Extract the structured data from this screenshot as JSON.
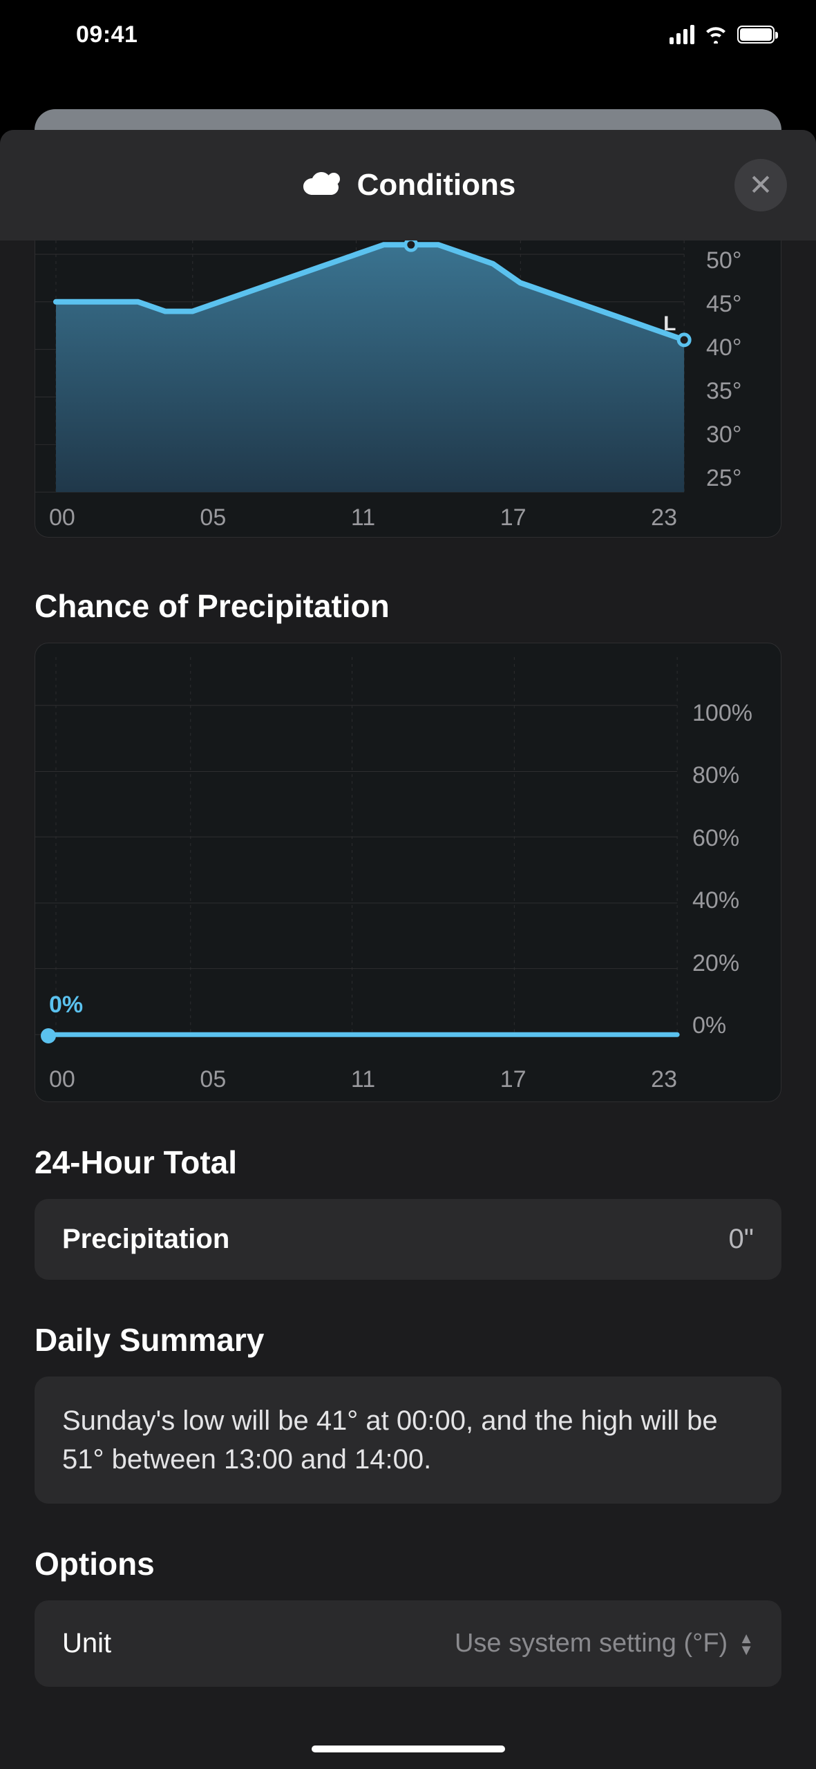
{
  "status": {
    "time": "09:41"
  },
  "sheet": {
    "title": "Conditions"
  },
  "chart_data": [
    {
      "type": "area",
      "name": "temperature",
      "x": [
        0,
        1,
        2,
        3,
        4,
        5,
        6,
        7,
        8,
        9,
        10,
        11,
        12,
        13,
        14,
        15,
        16,
        17,
        18,
        19,
        20,
        21,
        22,
        23
      ],
      "values": [
        45,
        45,
        45,
        45,
        44,
        44,
        45,
        46,
        47,
        48,
        49,
        50,
        51,
        51,
        51,
        50,
        49,
        47,
        46,
        45,
        44,
        43,
        42,
        41
      ],
      "x_ticks": [
        "00",
        "05",
        "11",
        "17",
        "23"
      ],
      "y_ticks": [
        "50°",
        "45°",
        "40°",
        "35°",
        "30°",
        "25°"
      ],
      "ylim": [
        25,
        50
      ],
      "markers": [
        {
          "x": 13,
          "value": 51,
          "label": ""
        },
        {
          "x": 23,
          "value": 41,
          "label": "L"
        }
      ],
      "line_color": "#5bc2ef",
      "fill_top": "#2d5f78",
      "fill_bottom": "#1b3646"
    },
    {
      "type": "line",
      "name": "chance_of_precipitation",
      "title": "Chance of Precipitation",
      "x": [
        0,
        1,
        2,
        3,
        4,
        5,
        6,
        7,
        8,
        9,
        10,
        11,
        12,
        13,
        14,
        15,
        16,
        17,
        18,
        19,
        20,
        21,
        22,
        23
      ],
      "values": [
        0,
        0,
        0,
        0,
        0,
        0,
        0,
        0,
        0,
        0,
        0,
        0,
        0,
        0,
        0,
        0,
        0,
        0,
        0,
        0,
        0,
        0,
        0,
        0
      ],
      "x_ticks": [
        "00",
        "05",
        "11",
        "17",
        "23"
      ],
      "y_ticks": [
        "100%",
        "80%",
        "60%",
        "40%",
        "20%",
        "0%"
      ],
      "ylim": [
        0,
        100
      ],
      "current_label": "0%",
      "line_color": "#5bc2ef"
    }
  ],
  "sections": {
    "precip_title": "Chance of Precipitation",
    "total_title": "24-Hour Total",
    "summary_title": "Daily Summary",
    "options_title": "Options"
  },
  "total": {
    "label": "Precipitation",
    "value": "0\""
  },
  "summary": {
    "text": "Sunday's low will be 41° at 00:00, and the high will be 51° between 13:00 and 14:00."
  },
  "options": {
    "unit_label": "Unit",
    "unit_value": "Use system setting (°F)"
  }
}
